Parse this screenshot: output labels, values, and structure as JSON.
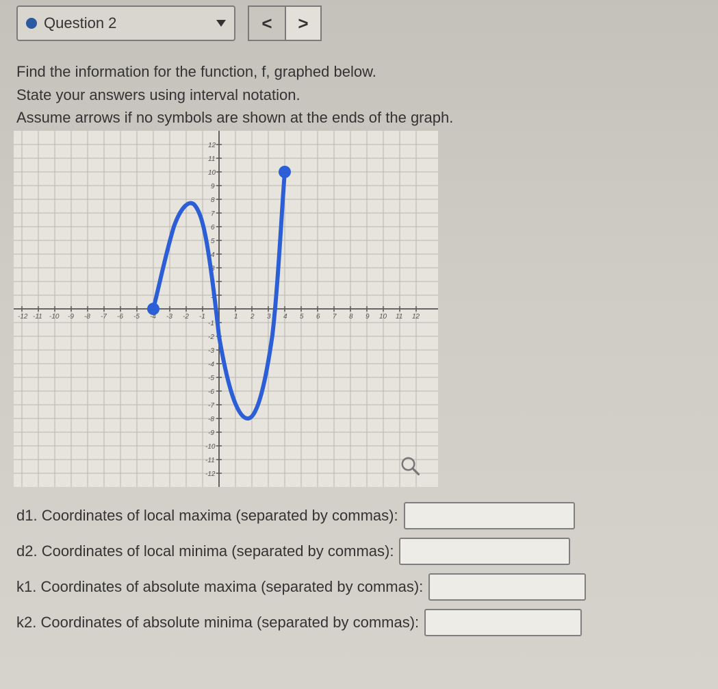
{
  "header": {
    "question_label": "Question 2",
    "prev": "<",
    "next": ">"
  },
  "instructions": {
    "line1": "Find the information for the function, f, graphed below.",
    "line2": "State your answers using interval notation.",
    "line3": "Assume arrows if no symbols are shown at the ends of the graph."
  },
  "questions": {
    "d1": "d1. Coordinates of local maxima (separated by commas):",
    "d2": "d2. Coordinates of local minima (separated by commas):",
    "k1": "k1. Coordinates of absolute maxima (separated by commas):",
    "k2": "k2. Coordinates of absolute minima (separated by commas):"
  },
  "answers": {
    "d1": "",
    "d2": "",
    "k1": "",
    "k2": ""
  },
  "chart_data": {
    "type": "line",
    "xlim": [
      -12,
      12
    ],
    "ylim": [
      -12,
      12
    ],
    "x_ticks": [
      -12,
      -11,
      -10,
      -9,
      -8,
      -7,
      -6,
      -5,
      -4,
      -3,
      -2,
      -1,
      1,
      2,
      3,
      4,
      5,
      6,
      7,
      8,
      9,
      10,
      11,
      12
    ],
    "y_ticks": [
      -12,
      -11,
      -10,
      -9,
      -8,
      -7,
      -6,
      -5,
      -4,
      -3,
      -2,
      -1,
      1,
      2,
      3,
      4,
      5,
      6,
      7,
      8,
      9,
      10,
      11,
      12
    ],
    "grid": true,
    "series": [
      {
        "name": "f",
        "color": "#2c5fd6",
        "endpoints": [
          {
            "x": -4,
            "y": 0,
            "type": "closed"
          },
          {
            "x": 4,
            "y": 10,
            "type": "closed"
          }
        ],
        "points": [
          {
            "x": -4,
            "y": 0
          },
          {
            "x": -3.5,
            "y": 2.5
          },
          {
            "x": -3,
            "y": 5.5
          },
          {
            "x": -2.5,
            "y": 7.5
          },
          {
            "x": -2,
            "y": 8
          },
          {
            "x": -1.5,
            "y": 7
          },
          {
            "x": -1,
            "y": 4.5
          },
          {
            "x": -0.5,
            "y": 1.5
          },
          {
            "x": 0,
            "y": -2
          },
          {
            "x": 0.5,
            "y": -5
          },
          {
            "x": 1,
            "y": -7
          },
          {
            "x": 1.5,
            "y": -8
          },
          {
            "x": 2,
            "y": -8
          },
          {
            "x": 2.5,
            "y": -6
          },
          {
            "x": 3,
            "y": -2
          },
          {
            "x": 3.5,
            "y": 4
          },
          {
            "x": 4,
            "y": 10
          }
        ],
        "local_max": {
          "x": -2,
          "y": 8
        },
        "local_min": {
          "x": 2,
          "y": -8
        },
        "absolute_max": {
          "x": 4,
          "y": 10
        },
        "absolute_min": {
          "x": 2,
          "y": -8
        }
      }
    ]
  }
}
